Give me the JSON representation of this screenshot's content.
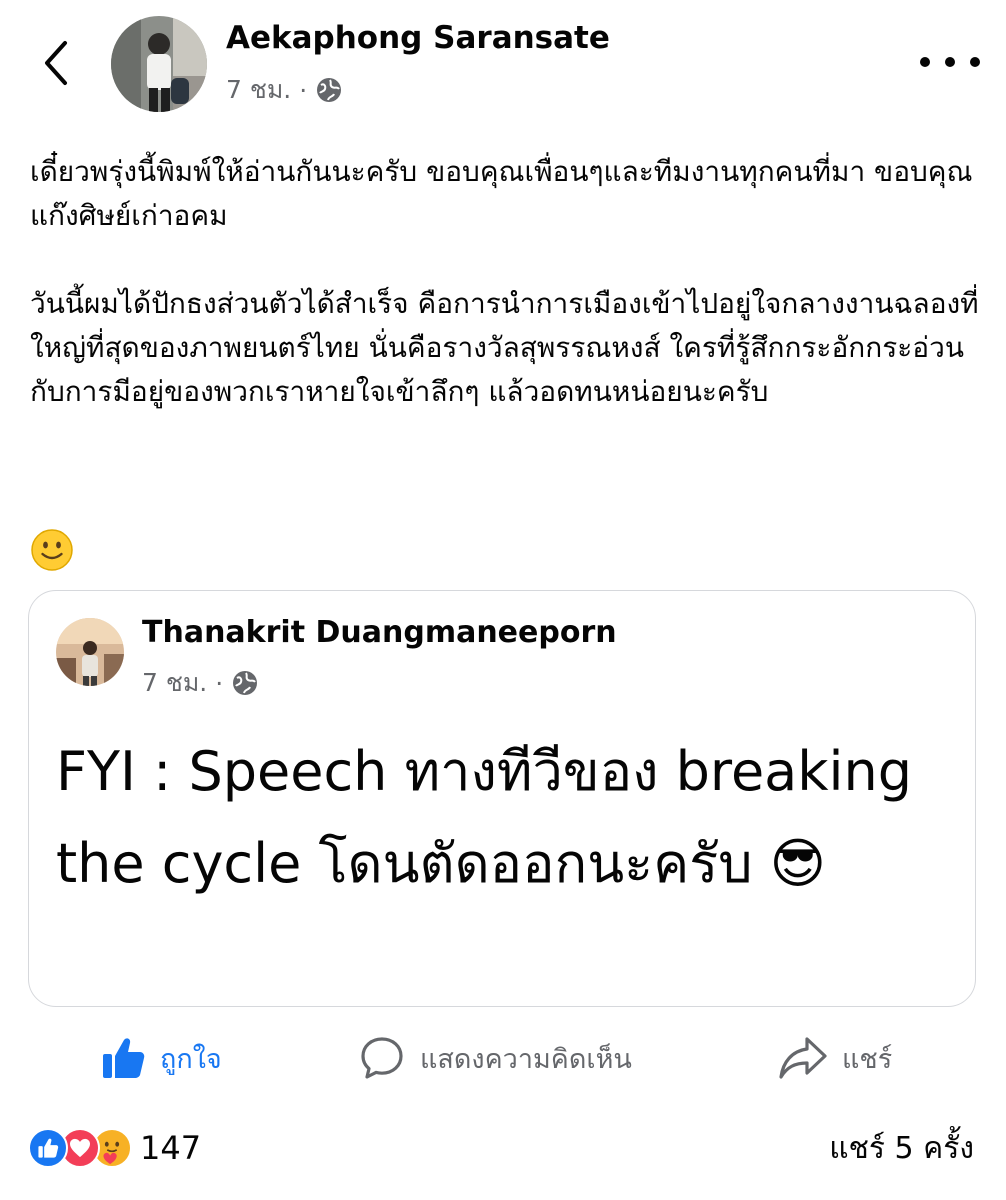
{
  "post": {
    "author": "Aekaphong Saransate",
    "time": "7 ชม.",
    "separator": "·",
    "text_paragraphs": [
      "เดี๋ยวพรุ่งนี้พิมพ์ให้อ่านกันนะครับ ขอบคุณเพื่อนๆและทีมงานทุกคนที่มา ขอบคุณแก๊งศิษย์เก่าอคม",
      "วันนี้ผมได้ปักธงส่วนตัวได้สำเร็จ คือการนำการเมืองเข้าไปอยู่ใจกลางงานฉลองที่ใหญ่ที่สุดของภาพยนตร์ไทย นั่นคือรางวัลสุพรรณหงส์ ใครที่รู้สึกกระอักกระอ่วนกับการมีอยู่ของพวกเราหายใจเข้าลึกๆ แล้วอดทนหน่อยนะครับ"
    ],
    "emoji": "slightly-smiling-face"
  },
  "shared_post": {
    "author": "Thanakrit Duangmaneeporn",
    "time": "7 ชม.",
    "separator": "·",
    "text": "FYI : Speech ทางทีวีของ breaking the cycle โดนตัดออกนะครับ 😎"
  },
  "actions": {
    "like": "ถูกใจ",
    "comment": "แสดงความคิดเห็น",
    "share": "แชร์"
  },
  "footer": {
    "reaction_count": "147",
    "share_count": "แชร์ 5 ครั้ง"
  },
  "colors": {
    "accent": "#1877f2",
    "muted": "#65676b",
    "love": "#f33e58",
    "care": "#f7b125"
  }
}
